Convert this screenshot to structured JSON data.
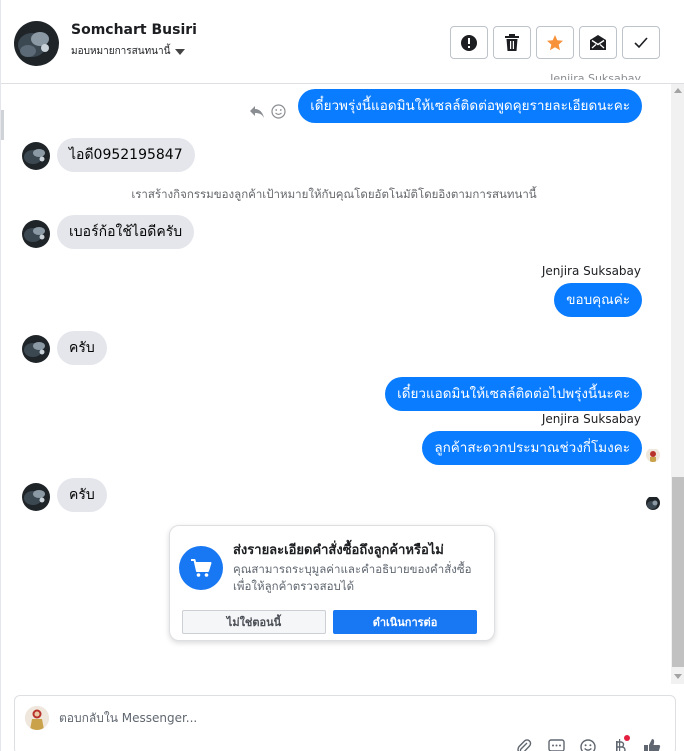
{
  "contact": {
    "name": "Somchart Busiri",
    "assign_label": "มอบหมายการสนทนานี้"
  },
  "header_actions": [
    {
      "icon": "alert-icon"
    },
    {
      "icon": "trash-icon"
    },
    {
      "icon": "star-icon",
      "color": "#f7923b"
    },
    {
      "icon": "mark-unread-icon"
    },
    {
      "icon": "check-icon"
    }
  ],
  "messages": [
    {
      "direction": "out",
      "text": "เดี๋ยวพรุ่งนี้แอดมินให้เซลล์ติดต่อพูดคุยรายละเอียดนะคะ"
    },
    {
      "direction": "in",
      "text": "ไอดี0952195847"
    },
    {
      "direction": "system",
      "text": "เราสร้างกิจกรรมของลูกค้าเป้าหมายให้กับคุณโดยอัตโนมัติโดยอิงตามการสนทนานี้"
    },
    {
      "direction": "in",
      "text": "เบอร์ก้อใช้ไอดีครับ"
    },
    {
      "direction": "out",
      "sender": "Jenjira Suksabay",
      "text": "ขอบคุณค่ะ"
    },
    {
      "direction": "in",
      "text": "ครับ"
    },
    {
      "direction": "out",
      "text": "เดี๋ยวแอดมินให้เซลล์ติดต่อไปพรุ่งนี้นะคะ"
    },
    {
      "direction": "out",
      "sender": "Jenjira Suksabay",
      "text": "ลูกค้าสะดวกประมาณช่วงกี่โมงคะ"
    },
    {
      "direction": "in",
      "text": "ครับ"
    }
  ],
  "order_card": {
    "title": "ส่งรายละเอียดคำสั่งซื้อถึงลูกค้าหรือไม่",
    "description": "คุณสามารถระบุมูลค่าและคำอธิบายของคำสั่งซื้อเพื่อให้ลูกค้าตรวจสอบได้",
    "decline_label": "ไม่ใช่ตอนนี้",
    "accept_label": "ดำเนินการต่อ"
  },
  "composer": {
    "placeholder": "ตอบกลับใน Messenger..."
  },
  "composer_tools": [
    "paperclip-icon",
    "saved-reply-icon",
    "emoji-icon",
    "currency-icon",
    "like-icon"
  ],
  "colors": {
    "outgoing_bubble": "#0a7cff",
    "incoming_bubble": "#e4e6eb",
    "primary": "#1877f2",
    "notification": "#e41e3f"
  }
}
